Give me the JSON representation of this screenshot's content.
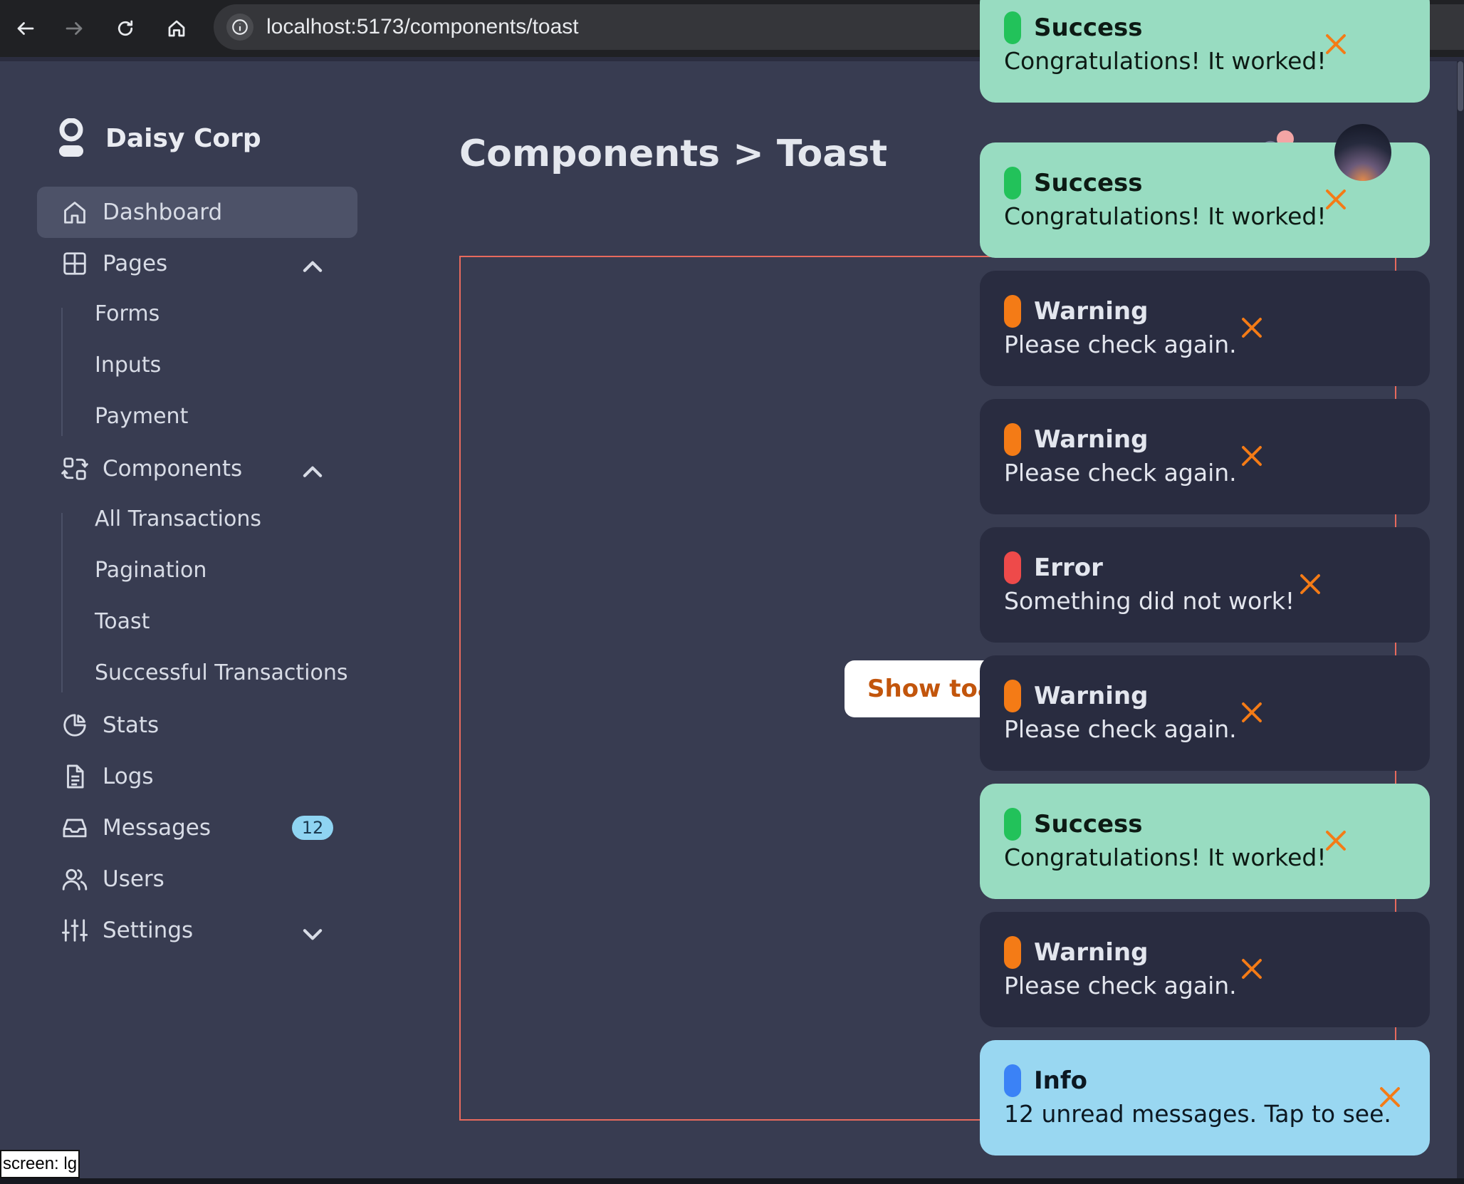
{
  "browser": {
    "url": "localhost:5173/components/toast",
    "icons": [
      "back-arrow-icon",
      "forward-arrow-icon",
      "reload-icon",
      "home-icon",
      "site-info-icon"
    ]
  },
  "brand": {
    "name": "Daisy Corp",
    "icon": "user-logo-icon"
  },
  "sidebar": {
    "items": [
      {
        "label": "Dashboard",
        "icon": "home-icon",
        "active": true
      },
      {
        "label": "Pages",
        "icon": "grid-icon",
        "expanded": true
      },
      {
        "label": "Components",
        "icon": "components-icon",
        "expanded": true
      },
      {
        "label": "Stats",
        "icon": "pie-chart-icon"
      },
      {
        "label": "Logs",
        "icon": "document-icon"
      },
      {
        "label": "Messages",
        "icon": "inbox-icon",
        "badge": "12"
      },
      {
        "label": "Users",
        "icon": "users-icon"
      },
      {
        "label": "Settings",
        "icon": "sliders-icon",
        "expanded": false
      }
    ],
    "pages_sub": [
      "Forms",
      "Inputs",
      "Payment"
    ],
    "components_sub": [
      "All Transactions",
      "Pagination",
      "Toast",
      "Successful Transactions"
    ]
  },
  "header": {
    "title": "Components > Toast"
  },
  "demo": {
    "button_label": "Show toast"
  },
  "toasts": [
    {
      "type": "success",
      "title": "Success",
      "message": "Congratulations! It worked!"
    },
    {
      "type": "success",
      "title": "Success",
      "message": "Congratulations! It worked!"
    },
    {
      "type": "warning",
      "title": "Warning",
      "message": "Please check again."
    },
    {
      "type": "warning",
      "title": "Warning",
      "message": "Please check again."
    },
    {
      "type": "error",
      "title": "Error",
      "message": "Something did not work!"
    },
    {
      "type": "warning",
      "title": "Warning",
      "message": "Please check again."
    },
    {
      "type": "success",
      "title": "Success",
      "message": "Congratulations! It worked!"
    },
    {
      "type": "warning",
      "title": "Warning",
      "message": "Please check again."
    },
    {
      "type": "info",
      "title": "Info",
      "message": "12 unread messages. Tap to see."
    }
  ],
  "colors": {
    "success": "#98dcc1",
    "warning_pill": "#f47b16",
    "error_pill": "#ee4a4a",
    "info": "#99d7f1",
    "close_icon": "#f47b16",
    "demo_border": "#e86a5d"
  },
  "debug": {
    "screen_label": "screen: lg"
  }
}
